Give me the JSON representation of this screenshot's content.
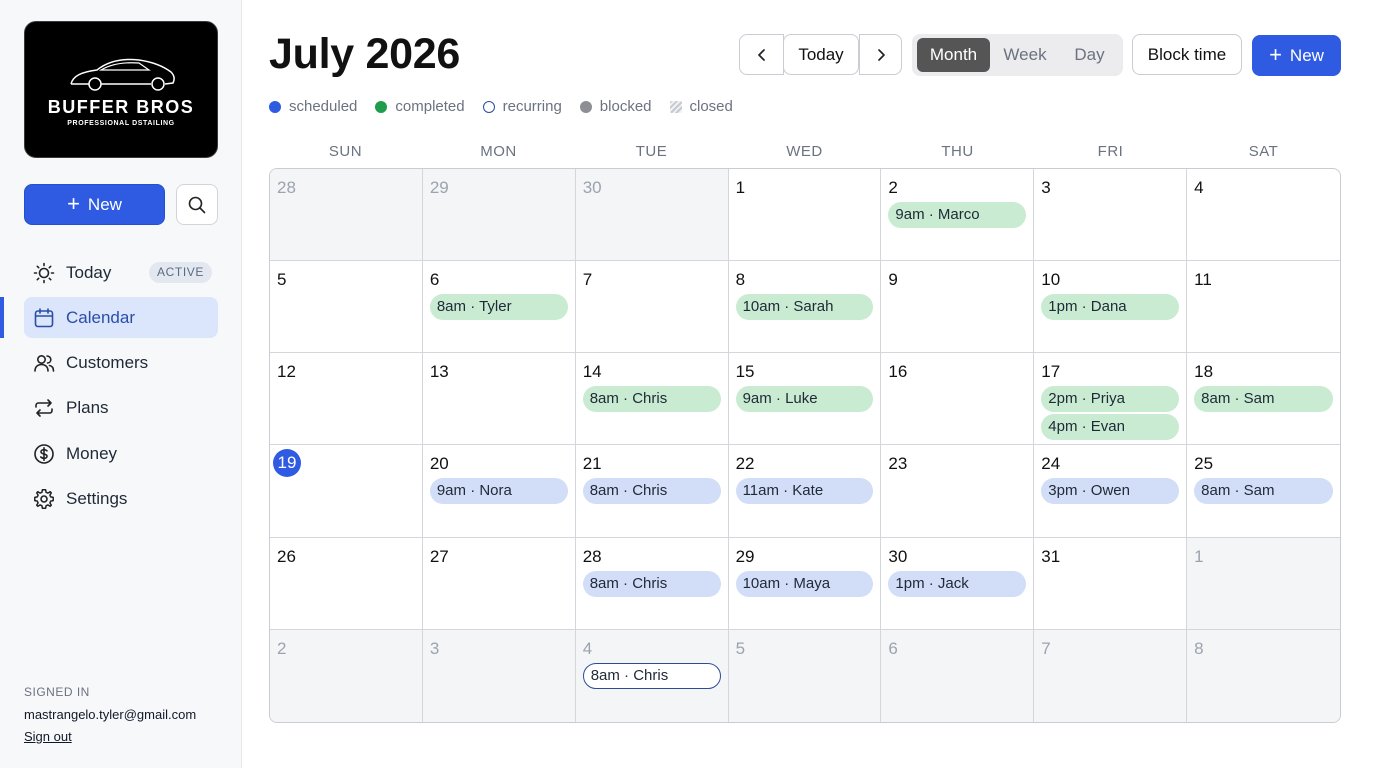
{
  "sidebar": {
    "logo": {
      "title": "BUFFER BROS",
      "subtitle": "PROFESSIONAL DSTAILING"
    },
    "new_label": "New",
    "nav": [
      {
        "label": "Today",
        "icon": "sun-icon",
        "badge": "ACTIVE"
      },
      {
        "label": "Calendar",
        "icon": "calendar-icon"
      },
      {
        "label": "Customers",
        "icon": "users-icon"
      },
      {
        "label": "Plans",
        "icon": "repeat-icon"
      },
      {
        "label": "Money",
        "icon": "dollar-icon"
      },
      {
        "label": "Settings",
        "icon": "gear-icon"
      }
    ],
    "signed_in_label": "SIGNED IN",
    "email": "mastrangelo.tyler@gmail.com",
    "sign_out": "Sign out"
  },
  "header": {
    "title": "July 2026",
    "today_label": "Today",
    "views": [
      "Month",
      "Week",
      "Day"
    ],
    "active_view": "Month",
    "block_time_label": "Block time",
    "new_label": "New"
  },
  "legend": [
    {
      "label": "scheduled",
      "color": "#2f5be3",
      "style": "solid"
    },
    {
      "label": "completed",
      "color": "#1f9d4c",
      "style": "solid"
    },
    {
      "label": "recurring",
      "color": "#2d4d9a",
      "style": "outline"
    },
    {
      "label": "blocked",
      "color": "#8d8f94",
      "style": "solid"
    },
    {
      "label": "closed",
      "color": "#b8bcc4",
      "style": "hatched"
    }
  ],
  "weekdays": [
    "SUN",
    "MON",
    "TUE",
    "WED",
    "THU",
    "FRI",
    "SAT"
  ],
  "today_day": 19,
  "calendar": [
    {
      "day": "28",
      "other": true,
      "events": []
    },
    {
      "day": "29",
      "other": true,
      "events": []
    },
    {
      "day": "30",
      "other": true,
      "events": []
    },
    {
      "day": "1",
      "events": []
    },
    {
      "day": "2",
      "events": [
        {
          "text": "9am · Marco",
          "status": "completed"
        }
      ]
    },
    {
      "day": "3",
      "events": []
    },
    {
      "day": "4",
      "events": []
    },
    {
      "day": "5",
      "events": []
    },
    {
      "day": "6",
      "events": [
        {
          "text": "8am · Tyler",
          "status": "completed"
        }
      ]
    },
    {
      "day": "7",
      "events": []
    },
    {
      "day": "8",
      "events": [
        {
          "text": "10am · Sarah",
          "status": "completed"
        }
      ]
    },
    {
      "day": "9",
      "events": []
    },
    {
      "day": "10",
      "events": [
        {
          "text": "1pm · Dana",
          "status": "completed"
        }
      ]
    },
    {
      "day": "11",
      "events": []
    },
    {
      "day": "12",
      "events": []
    },
    {
      "day": "13",
      "events": []
    },
    {
      "day": "14",
      "events": [
        {
          "text": "8am · Chris",
          "status": "completed"
        }
      ]
    },
    {
      "day": "15",
      "events": [
        {
          "text": "9am · Luke",
          "status": "completed"
        }
      ]
    },
    {
      "day": "16",
      "events": []
    },
    {
      "day": "17",
      "events": [
        {
          "text": "2pm · Priya",
          "status": "completed"
        },
        {
          "text": "4pm · Evan",
          "status": "completed"
        }
      ]
    },
    {
      "day": "18",
      "events": [
        {
          "text": "8am · Sam",
          "status": "completed"
        }
      ]
    },
    {
      "day": "19",
      "today": true,
      "events": []
    },
    {
      "day": "20",
      "events": [
        {
          "text": "9am · Nora",
          "status": "scheduled"
        }
      ]
    },
    {
      "day": "21",
      "events": [
        {
          "text": "8am · Chris",
          "status": "scheduled"
        }
      ]
    },
    {
      "day": "22",
      "events": [
        {
          "text": "11am · Kate",
          "status": "scheduled"
        }
      ]
    },
    {
      "day": "23",
      "events": []
    },
    {
      "day": "24",
      "events": [
        {
          "text": "3pm · Owen",
          "status": "scheduled"
        }
      ]
    },
    {
      "day": "25",
      "events": [
        {
          "text": "8am · Sam",
          "status": "scheduled"
        }
      ]
    },
    {
      "day": "26",
      "events": []
    },
    {
      "day": "27",
      "events": []
    },
    {
      "day": "28",
      "events": [
        {
          "text": "8am · Chris",
          "status": "scheduled"
        }
      ]
    },
    {
      "day": "29",
      "events": [
        {
          "text": "10am · Maya",
          "status": "scheduled"
        }
      ]
    },
    {
      "day": "30",
      "events": [
        {
          "text": "1pm · Jack",
          "status": "scheduled"
        }
      ]
    },
    {
      "day": "31",
      "events": []
    },
    {
      "day": "1",
      "other": true,
      "events": []
    },
    {
      "day": "2",
      "other": true,
      "events": []
    },
    {
      "day": "3",
      "other": true,
      "events": []
    },
    {
      "day": "4",
      "other": true,
      "events": [
        {
          "text": "8am · Chris",
          "status": "recurring"
        }
      ]
    },
    {
      "day": "5",
      "other": true,
      "events": []
    },
    {
      "day": "6",
      "other": true,
      "events": []
    },
    {
      "day": "7",
      "other": true,
      "events": []
    },
    {
      "day": "8",
      "other": true,
      "events": []
    }
  ]
}
